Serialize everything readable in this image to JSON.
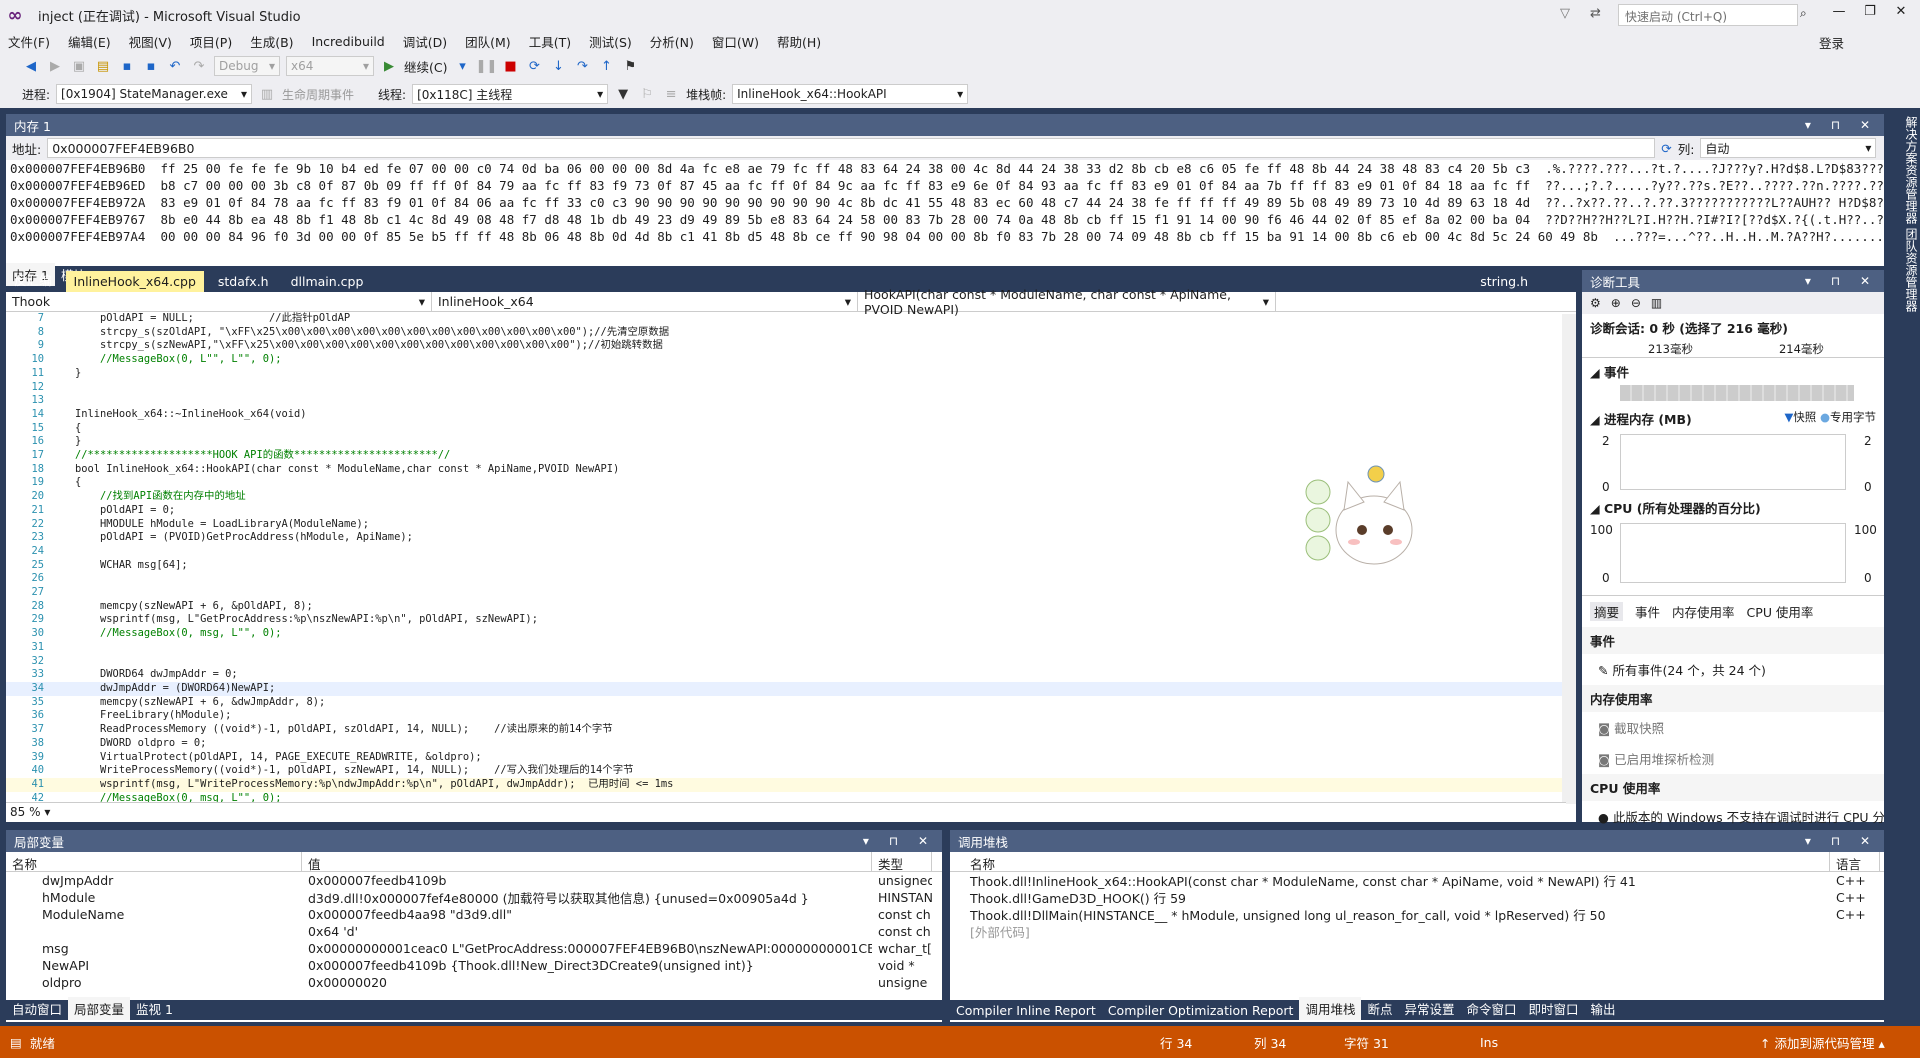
{
  "titlebar": {
    "title": "inject (正在调试) - Microsoft Visual Studio",
    "quicklaunch": "快速启动 (Ctrl+Q)"
  },
  "menu": [
    "文件(F)",
    "编辑(E)",
    "视图(V)",
    "项目(P)",
    "生成(B)",
    "Incredibuild",
    "调试(D)",
    "团队(M)",
    "工具(T)",
    "测试(S)",
    "分析(N)",
    "窗口(W)",
    "帮助(H)"
  ],
  "login": "登录",
  "toolbar1": {
    "config": "Debug",
    "platform": "x64",
    "continue": "继续(C)"
  },
  "toolbar2": {
    "process_label": "进程:",
    "process": "[0x1904] StateManager.exe",
    "lifecycle": "生命周期事件",
    "thread_label": "线程:",
    "thread": "[0x118C] 主线程",
    "frame_label": "堆栈帧:",
    "frame": "InlineHook_x64::HookAPI"
  },
  "memory": {
    "title": "内存 1",
    "addr_label": "地址:",
    "addr": "0x000007FEF4EB96B0",
    "col_label": "列:",
    "col": "自动",
    "lines": [
      "0x000007FEF4EB96B0  ff 25 00 fe fe fe 9b 10 b4 ed fe 07 00 00 c0 74 0d ba 06 00 00 00 8d 4a fc e8 ae 79 fc ff 48 83 64 24 38 00 4c 8d 44 24 38 33 d2 8b cb e8 c6 05 fe ff 48 8b 44 24 38 48 83 c4 20 5b c3  .%.????.???...?t.?....?J???y?.H?d$8.L?D$83?????.?.H?D$8H?? [?",
      "0x000007FEF4EB96ED  b8 c7 00 00 00 3b c8 0f 87 0b 09 ff ff 0f 84 79 aa fc ff 83 f9 73 0f 87 45 aa fc ff 0f 84 9c aa fc ff 83 e9 6e 0f 84 93 aa fc ff 83 e9 01 0f 84 aa 7b ff ff 83 e9 01 0f 84 18 aa fc ff  ??...;?.?.....?y??.??s.?E??..????.??n.????.??...??{..??..?.??.",
      "0x000007FEF4EB972A  83 e9 01 0f 84 78 aa fc ff 83 f9 01 0f 84 06 aa fc ff 33 c0 c3 90 90 90 90 90 90 90 90 90 4c 8b dc 41 55 48 83 ec 60 48 c7 44 24 38 fe ff ff ff 49 89 5b 08 49 89 73 10 4d 89 63 18 4d  ??..?x??.??..?.??.3???????????L??AUH?? H?D$8?...I?[.I?s.M?c.M",
      "0x000007FEF4EB9767  8b e0 44 8b ea 48 8b f1 48 8b c1 4c 8d 49 08 48 f7 d8 48 1b db 49 23 d9 49 89 5b e8 83 64 24 58 00 83 7b 28 00 74 0a 48 8b cb ff 15 f1 91 14 00 90 f6 46 44 02 0f 85 ef 8a 02 00 ba 04  ??D??H??H??L?I.H??H.?I#?I?[??d$X.?{(.t.H??..??..??FD..?..?..?.",
      "0x000007FEF4EB97A4  00 00 00 84 96 f0 3d 00 00 0f 85 5e b5 ff ff 48 8b 06 48 8b 0d 4d 8b c1 41 8b d5 48 8b ce ff 90 98 04 00 00 8b f0 83 7b 28 00 74 09 48 8b cb ff 15 ba 91 14 00 8b c6 eb 00 4c 8d 5c 24 60 49 8b  ...???=...^??..H..H..M.?A??H?..........?{(.t.H??..??....??.L?\\$`I?"
    ]
  },
  "memtabs": [
    "内存 1",
    "模块"
  ],
  "doctabs": [
    "反汇编",
    "InlineHook_x64.cpp",
    "stdafx.h",
    "dllmain.cpp",
    "string.h"
  ],
  "nav": {
    "a": "Thook",
    "b": "InlineHook_x64",
    "c": "HookAPI(char const * ModuleName, char const * ApiName, PVOID NewAPI)"
  },
  "zoom": "85 %",
  "diag": {
    "title": "诊断工具",
    "session": "诊断会话: 0 秒 (选择了 216 毫秒)",
    "t1": "213毫秒",
    "t2": "214毫秒",
    "events": "事件",
    "procmem": "进程内存 (MB)",
    "snap": "快照",
    "priv": "专用字节",
    "mem_max": "2",
    "mem_min": "0",
    "cpu": "CPU (所有处理器的百分比)",
    "cpu_max": "100",
    "cpu_min": "0",
    "tabs": [
      "摘要",
      "事件",
      "内存使用率",
      "CPU 使用率"
    ],
    "ev_hdr": "事件",
    "ev_all": "所有事件(24 个，共 24 个)",
    "mem_hdr": "内存使用率",
    "take_snap": "截取快照",
    "heap": "已启用堆探析检测",
    "cpu_hdr": "CPU 使用率",
    "cpu_note": "此版本的 Windows 不支持在调试时进行 CPU 分"
  },
  "locals": {
    "title": "局部变量",
    "cols": [
      "名称",
      "值",
      "类型"
    ],
    "rows": [
      [
        "dwJmpAddr",
        "0x000007feedb4109b",
        "unsigned"
      ],
      [
        "hModule",
        "d3d9.dll!0x000007fef4e80000 (加载符号以获取其他信息) {unused=0x00905a4d }",
        "HINSTAN"
      ],
      [
        "ModuleName",
        "0x000007feedb4aa98 \"d3d9.dll\"",
        "const ch"
      ],
      [
        "",
        "0x64 'd'",
        "const ch"
      ],
      [
        "msg",
        "0x00000000001ceac0 L\"GetProcAddress:000007FEF4EB96B0\\nszNewAPI:00000000001CECAE\\n\"",
        "wchar_t["
      ],
      [
        "NewAPI",
        "0x000007feedb4109b {Thook.dll!New_Direct3DCreate9(unsigned int)}",
        "void *"
      ],
      [
        "oldpro",
        "0x00000020",
        "unsigne"
      ]
    ],
    "tabs": [
      "自动窗口",
      "局部变量",
      "监视 1"
    ]
  },
  "callstack": {
    "title": "调用堆栈",
    "cols": [
      "名称",
      "语言"
    ],
    "rows": [
      [
        "Thook.dll!InlineHook_x64::HookAPI(const char * ModuleName, const char * ApiName, void * NewAPI) 行 41",
        "C++"
      ],
      [
        "Thook.dll!GameD3D_HOOK() 行 59",
        "C++"
      ],
      [
        "Thook.dll!DllMain(HINSTANCE__ * hModule, unsigned long ul_reason_for_call, void * lpReserved) 行 50",
        "C++"
      ],
      [
        "[外部代码]",
        ""
      ]
    ],
    "tabs": [
      "Compiler Inline Report",
      "Compiler Optimization Report",
      "调用堆栈",
      "断点",
      "异常设置",
      "命令窗口",
      "即时窗口",
      "输出"
    ]
  },
  "status": {
    "ready": "就绪",
    "line": "行 34",
    "col": "列 34",
    "char": "字符 31",
    "ins": "Ins",
    "source": "添加到源代码管理"
  },
  "rightside": "解决方案资源管理器 团队资源管理器",
  "code": [
    [
      "7",
      "        pOldAPI = NULL;            //此指针pOldAP"
    ],
    [
      "8",
      "        strcpy_s(szOldAPI, \"\\xFF\\x25\\x00\\x00\\x00\\x00\\x00\\x00\\x00\\x00\\x00\\x00\\x00\\x00\");//先清空原数据"
    ],
    [
      "9",
      "        strcpy_s(szNewAPI,\"\\xFF\\x25\\x00\\x00\\x00\\x00\\x00\\x00\\x00\\x00\\x00\\x00\\x00\\x00\");//初始跳转数据"
    ],
    [
      "10",
      "        //MessageBox(0, L\"\", L\"\", 0);"
    ],
    [
      "11",
      "    }"
    ],
    [
      "12",
      ""
    ],
    [
      "13",
      ""
    ],
    [
      "14",
      "    InlineHook_x64::~InlineHook_x64(void)"
    ],
    [
      "15",
      "    {"
    ],
    [
      "16",
      "    }"
    ],
    [
      "17",
      "    //********************HOOK API的函数***********************//"
    ],
    [
      "18",
      "    bool InlineHook_x64::HookAPI(char const * ModuleName,char const * ApiName,PVOID NewAPI)"
    ],
    [
      "19",
      "    {"
    ],
    [
      "20",
      "        //找到API函数在内存中的地址"
    ],
    [
      "21",
      "        pOldAPI = 0;"
    ],
    [
      "22",
      "        HMODULE hModule = LoadLibraryA(ModuleName);"
    ],
    [
      "23",
      "        pOldAPI = (PVOID)GetProcAddress(hModule, ApiName);"
    ],
    [
      "24",
      ""
    ],
    [
      "25",
      "        WCHAR msg[64];"
    ],
    [
      "26",
      ""
    ],
    [
      "27",
      ""
    ],
    [
      "28",
      "        memcpy(szNewAPI + 6, &pOldAPI, 8);"
    ],
    [
      "29",
      "        wsprintf(msg, L\"GetProcAddress:%p\\nszNewAPI:%p\\n\", pOldAPI, szNewAPI);"
    ],
    [
      "30",
      "        //MessageBox(0, msg, L\"\", 0);"
    ],
    [
      "31",
      ""
    ],
    [
      "32",
      ""
    ],
    [
      "33",
      "        DWORD64 dwJmpAddr = 0;"
    ],
    [
      "34",
      "        dwJmpAddr = (DWORD64)NewAPI;"
    ],
    [
      "35",
      "        memcpy(szNewAPI + 6, &dwJmpAddr, 8);"
    ],
    [
      "36",
      "        FreeLibrary(hModule);"
    ],
    [
      "37",
      "        ReadProcessMemory ((void*)-1, pOldAPI, szOldAPI, 14, NULL);    //读出原来的前14个字节"
    ],
    [
      "38",
      "        DWORD oldpro = 0;"
    ],
    [
      "39",
      "        VirtualProtect(pOldAPI, 14, PAGE_EXECUTE_READWRITE, &oldpro);"
    ],
    [
      "40",
      "        WriteProcessMemory((void*)-1, pOldAPI, szNewAPI, 14, NULL);    //写入我们处理后的14个字节"
    ],
    [
      "41",
      "        wsprintf(msg, L\"WriteProcessMemory:%p\\ndwJmpAddr:%p\\n\", pOldAPI, dwJmpAddr);  已用时间 <= 1ms"
    ],
    [
      "42",
      "        //MessageBox(0, msg, L\"\", 0);"
    ]
  ]
}
